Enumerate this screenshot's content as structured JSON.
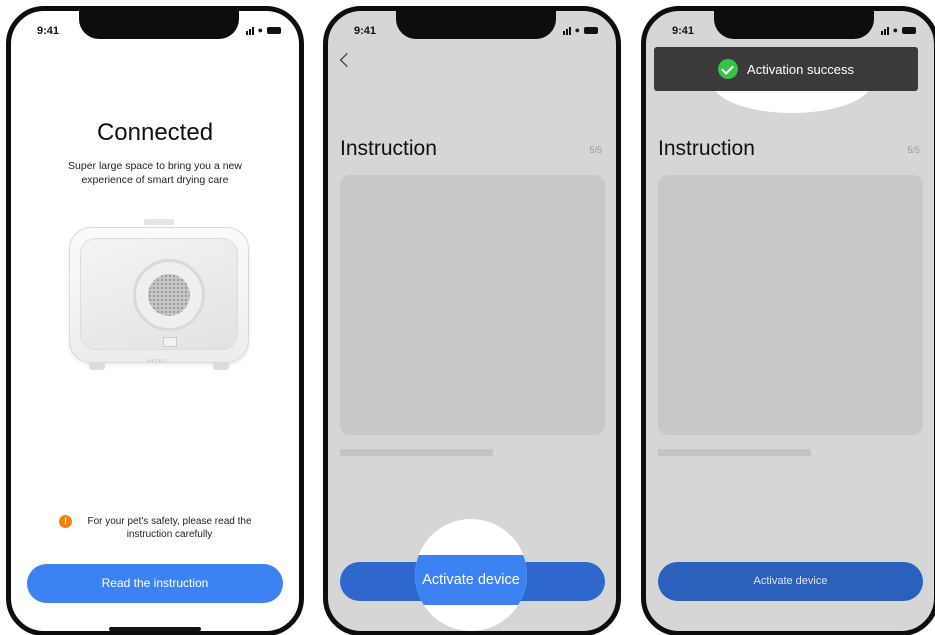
{
  "status_bar": {
    "time": "9:41"
  },
  "screen_connected": {
    "title": "Connected",
    "subtitle": "Super large space to bring you a new experience of smart drying care",
    "device_logo": "PETKIT",
    "warning_icon": "exclamation-icon",
    "warning_icon_glyph": "!",
    "warning_color": "#f0820f",
    "warning_text": "For your pet's safety, please read the instruction carefully",
    "button_label": "Read the instruction",
    "button_color": "#3d82f2"
  },
  "screen_instruction": {
    "title": "Instruction",
    "page_counter": "5/5",
    "button_label": "Activate device",
    "magnified_label": "Activate device"
  },
  "screen_activated": {
    "title": "Instruction",
    "page_counter": "5/5",
    "toast_icon": "check-circle-icon",
    "toast_icon_color": "#34c24a",
    "toast_text": "Activation success",
    "button_label": "Activate device"
  }
}
